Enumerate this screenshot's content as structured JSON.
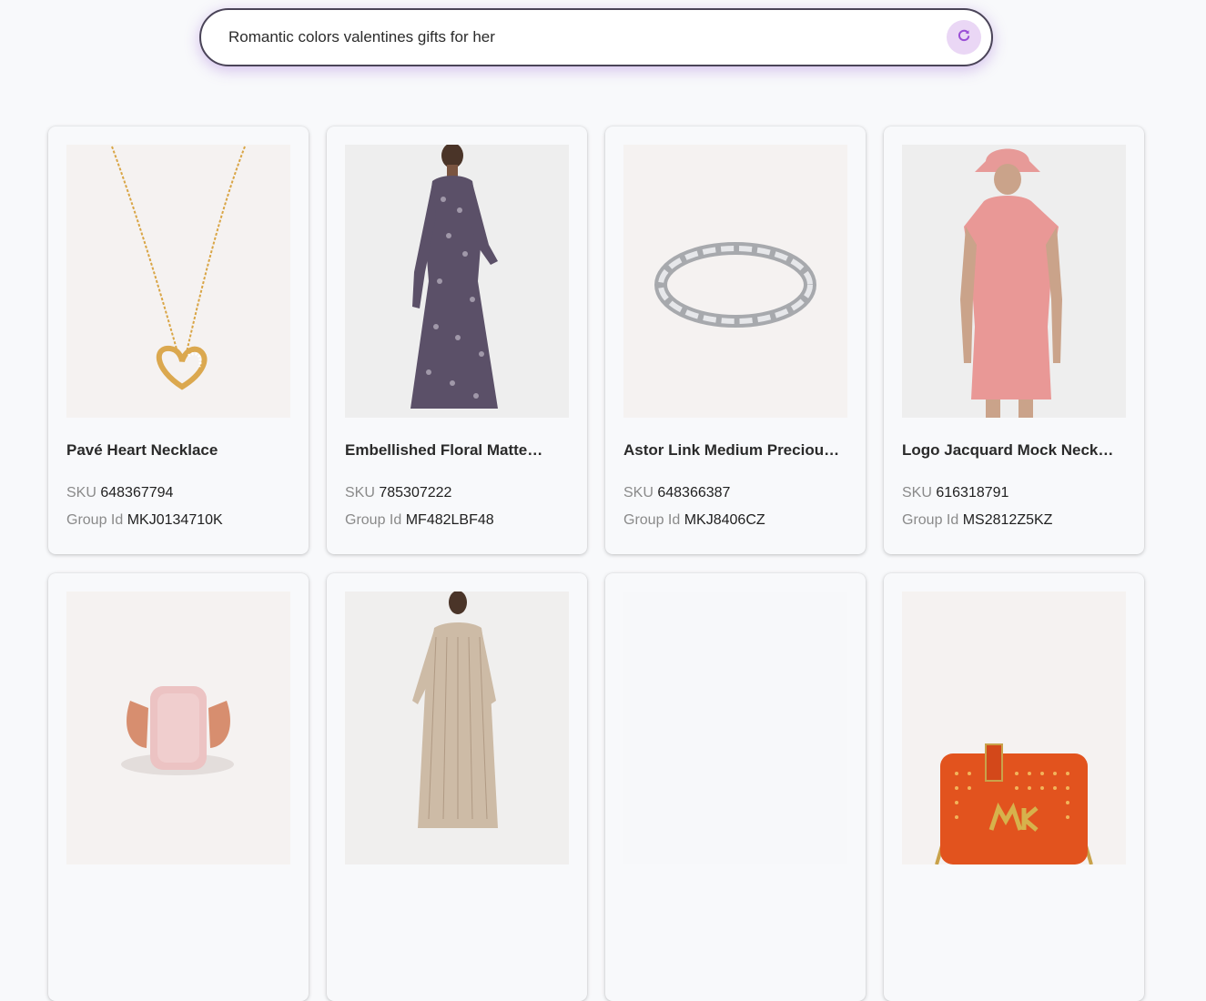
{
  "search": {
    "query": "Romantic colors valentines gifts for her",
    "refresh_icon": "refresh-icon",
    "accent_color": "#9b4fd6"
  },
  "products": [
    {
      "title": "Pavé Heart Necklace",
      "sku_label": "SKU",
      "sku": "648367794",
      "group_label": "Group Id",
      "group_id": "MKJ0134710K",
      "image": "gold-heart-necklace"
    },
    {
      "title": "Embellished Floral Matte…",
      "sku_label": "SKU",
      "sku": "785307222",
      "group_label": "Group Id",
      "group_id": "MF482LBF48",
      "image": "floral-midi-dress-model"
    },
    {
      "title": "Astor Link Medium Precious…",
      "sku_label": "SKU",
      "sku": "648366387",
      "group_label": "Group Id",
      "group_id": "MKJ8406CZ",
      "image": "silver-link-bracelet"
    },
    {
      "title": "Logo Jacquard Mock Neck…",
      "sku_label": "SKU",
      "sku": "616318791",
      "group_label": "Group Id",
      "group_id": "MS2812Z5KZ",
      "image": "pink-knit-dress-model"
    },
    {
      "image": "rose-quartz-ring"
    },
    {
      "image": "striped-shirt-dress-model"
    },
    {
      "image": "loading-placeholder"
    },
    {
      "image": "orange-studded-crossbody-bag"
    }
  ]
}
